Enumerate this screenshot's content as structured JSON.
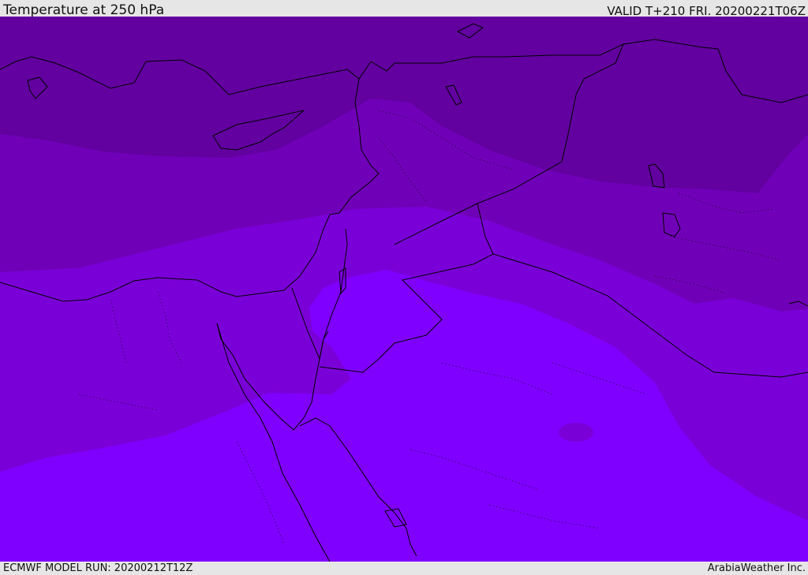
{
  "header": {
    "title": "Temperature at 250 hPa",
    "valid": "VALID T+210 FRI. 20200221T06Z"
  },
  "footer": {
    "model_run": "ECMWF MODEL RUN: 20200212T12Z",
    "credit": "ArabiaWeather Inc."
  },
  "colors": {
    "band_coldest": "#6200a0",
    "band_cold": "#7000b8",
    "band_mid": "#7a00d8",
    "band_warm": "#7f00ff",
    "coastline": "#000000"
  }
}
